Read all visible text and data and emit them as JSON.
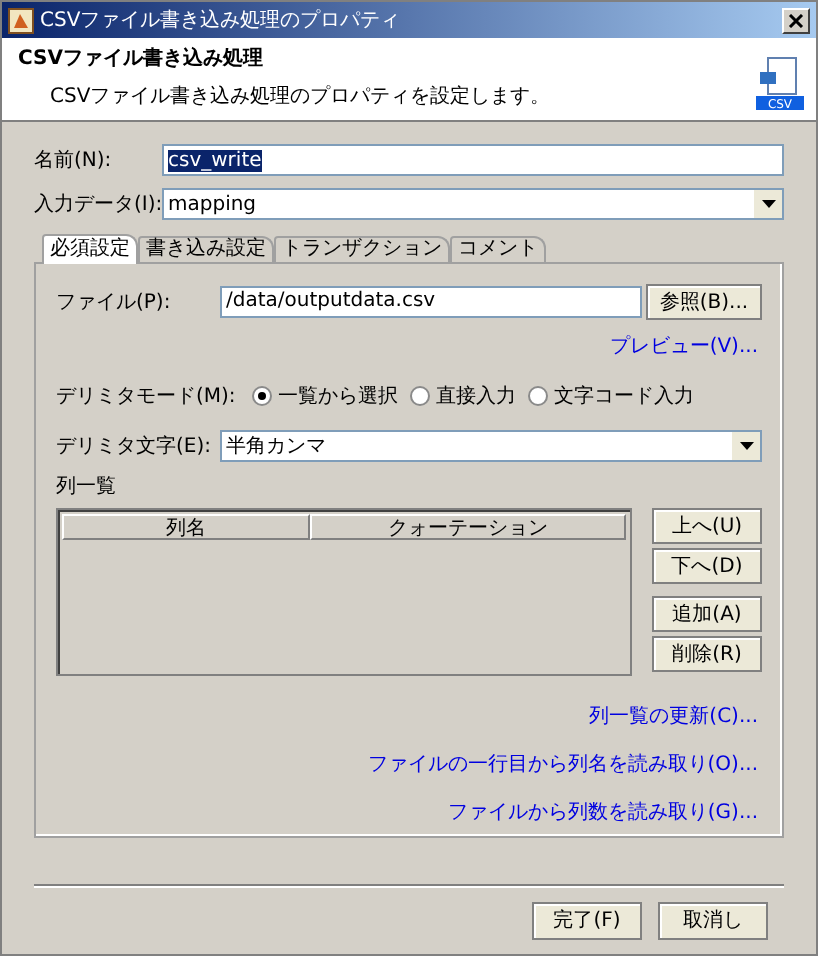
{
  "window": {
    "title": "CSVファイル書き込み処理のプロパティ"
  },
  "header": {
    "title": "CSVファイル書き込み処理",
    "description": "CSVファイル書き込み処理のプロパティを設定します。",
    "icon_label": "CSV"
  },
  "fields": [
    {
      "kind": "text",
      "label": "名前(N):",
      "value": "csv_write",
      "text_selected": true
    },
    {
      "kind": "dropdown",
      "label": "入力データ(I):",
      "value": "mapping"
    }
  ],
  "tabs": [
    {
      "label": "必須設定",
      "selected": true
    },
    {
      "label": "書き込み設定",
      "selected": false
    },
    {
      "label": "トランザクション",
      "selected": false
    },
    {
      "label": "コメント",
      "selected": false
    }
  ],
  "tab_panel": {
    "file": {
      "label": "ファイル(P):",
      "value": "/data/outputdata.csv",
      "button": "参照(B)..."
    },
    "preview_link": "プレビュー(V)...",
    "delimiter_mode": {
      "label": "デリミタモード(M):",
      "options": [
        {
          "label": "一覧から選択",
          "selected": true
        },
        {
          "label": "直接入力",
          "selected": false
        },
        {
          "label": "文字コード入力",
          "selected": false
        }
      ]
    },
    "delimiter_char": {
      "label": "デリミタ文字(E):",
      "value": "半角カンマ"
    },
    "column_list": {
      "title": "列一覧",
      "columns": [
        "列名",
        "クォーテーション"
      ],
      "buttons": [
        "上へ(U)",
        "下へ(D)",
        "追加(A)",
        "削除(R)"
      ]
    },
    "links": [
      "列一覧の更新(C)...",
      "ファイルの一行目から列名を読み取り(O)...",
      "ファイルから列数を読み取り(G)..."
    ]
  },
  "buttons": [
    "完了(F)",
    "取消し"
  ]
}
